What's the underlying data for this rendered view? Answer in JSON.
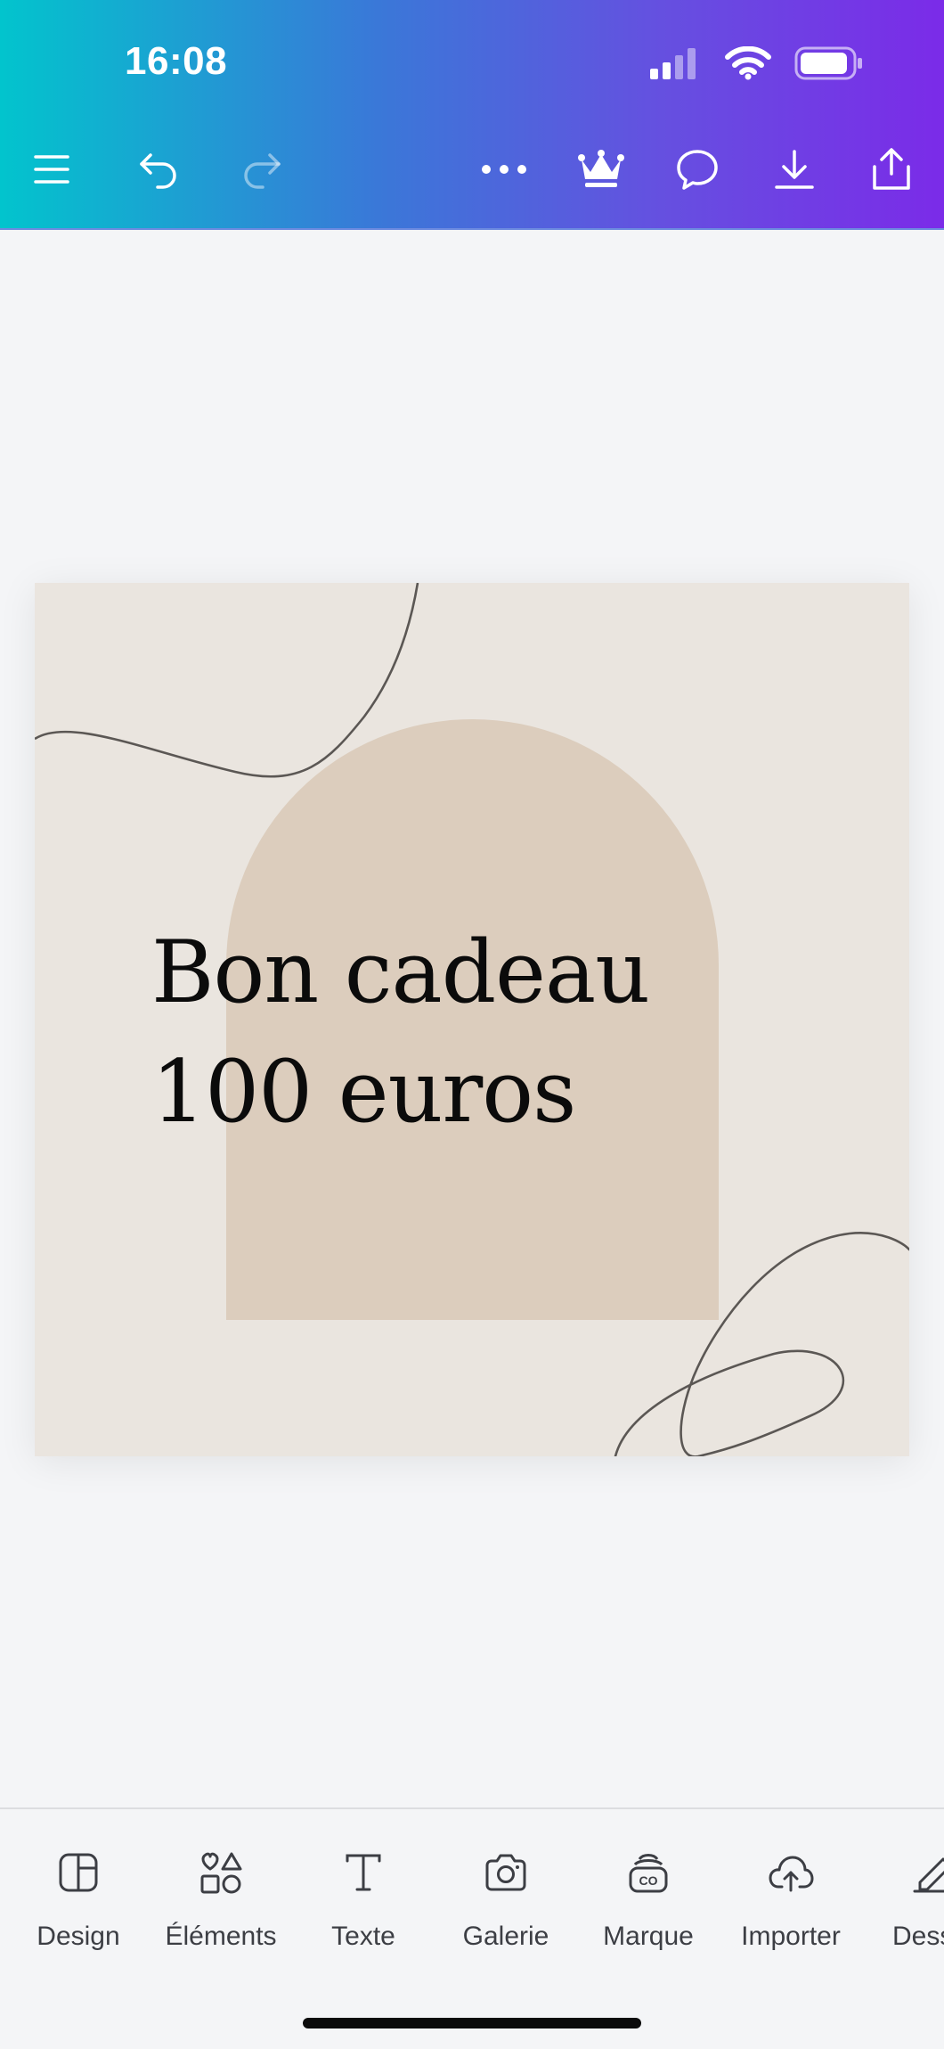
{
  "status_bar": {
    "time": "16:08"
  },
  "canvas": {
    "headline_line1": "Bon cadeau",
    "headline_line2": "100 euros"
  },
  "bottom_nav": {
    "items": [
      {
        "label": "Design",
        "icon": "layout-icon"
      },
      {
        "label": "Éléments",
        "icon": "shapes-icon"
      },
      {
        "label": "Texte",
        "icon": "text-icon"
      },
      {
        "label": "Galerie",
        "icon": "camera-icon"
      },
      {
        "label": "Marque",
        "icon": "brand-icon"
      },
      {
        "label": "Importer",
        "icon": "upload-cloud-icon"
      },
      {
        "label": "Dess",
        "icon": "draw-icon"
      }
    ]
  },
  "colors": {
    "gradient_start": "#02c4cd",
    "gradient_end": "#7b2be8",
    "canvas_bg": "#eae5df",
    "arch": "#dccdbd"
  }
}
